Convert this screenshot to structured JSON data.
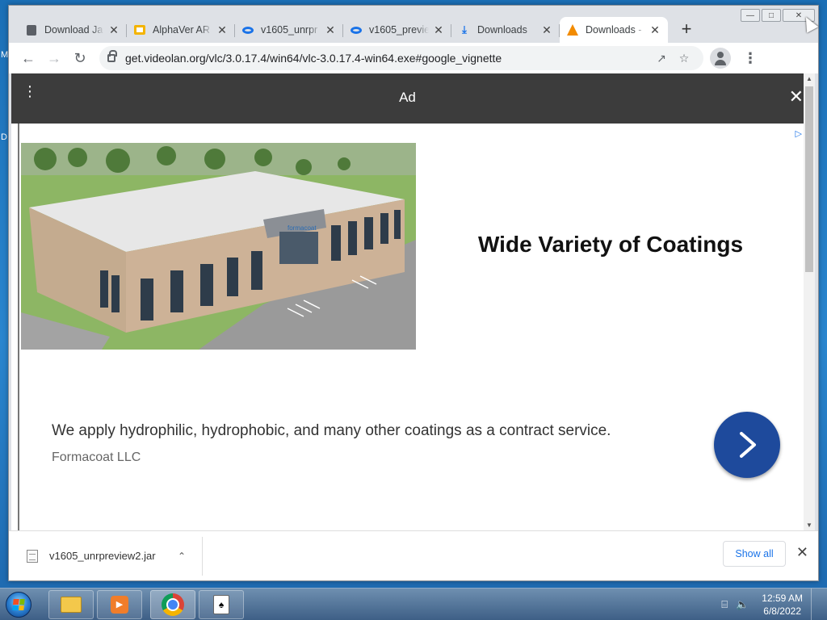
{
  "desktop": {
    "edge_label_top": "M",
    "edge_label_mid": "D"
  },
  "window_controls": {
    "minimize": "—",
    "maximize": "□",
    "close": "✕"
  },
  "tabs": [
    {
      "label": "Download Ja",
      "icon": "document-icon",
      "active": false
    },
    {
      "label": "AlphaVer AR",
      "icon": "slides-icon",
      "active": false
    },
    {
      "label": "v1605_unrpr",
      "icon": "blue-ring-icon",
      "active": false
    },
    {
      "label": "v1605_previe",
      "icon": "blue-ring-icon",
      "active": false
    },
    {
      "label": "Downloads",
      "icon": "download-icon",
      "active": false
    },
    {
      "label": "Downloads -",
      "icon": "vlc-cone-icon",
      "active": true
    }
  ],
  "tab_close_glyph": "✕",
  "new_tab_glyph": "+",
  "toolbar": {
    "back": "←",
    "forward": "→",
    "reload": "↻",
    "url": "get.videolan.org/vlc/3.0.17.4/win64/vlc-3.0.17.4-win64.exe#google_vignette",
    "share_glyph": "↗",
    "star_glyph": "☆",
    "menu_glyph": "⋮"
  },
  "ad": {
    "bar_title": "Ad",
    "bar_menu": "⋮",
    "close_glyph": "✕",
    "adchoices_glyph": "▷",
    "headline": "Wide Variety of Coatings",
    "description": "We apply hydrophilic, hydrophobic, and many other coatings as a contract service.",
    "advertiser": "Formacoat LLC",
    "building_sign": "formacoat",
    "cta_color": "#1e4a9c"
  },
  "scrollbar": {
    "up": "▲",
    "down": "▼"
  },
  "download_shelf": {
    "file_name": "v1605_unrpreview2.jar",
    "chevron": "⌃",
    "show_all": "Show all",
    "close_glyph": "✕"
  },
  "taskbar": {
    "apps": [
      "windows-explorer",
      "media-player",
      "google-chrome",
      "solitaire"
    ],
    "active_app": "google-chrome",
    "time": "12:59 AM",
    "date": "6/8/2022",
    "network_glyph": "⌸",
    "volume_glyph": "🔈"
  }
}
